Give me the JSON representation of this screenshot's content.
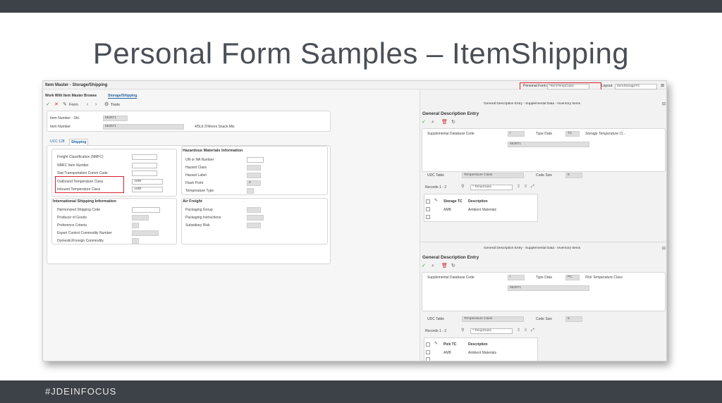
{
  "slide": {
    "title": "Personal Form Samples – ItemShipping",
    "hashtag": "#JDEINFOCUS"
  },
  "app": {
    "window_title": "Item Master - Storage/Shipping",
    "breadcrumb_1": "Work With Item Master Browse",
    "breadcrumb_2": "Storage/Shipping",
    "personal_form_label": "Personal Form:",
    "personal_form_value": "*ItemTempClass",
    "layout_label": "Layout:",
    "layout_value": "ItemStorageTC",
    "toolbar": {
      "form": "Form",
      "tools": "Tools"
    }
  },
  "item": {
    "item_number_short_label": "Item Number - Sht",
    "item_number_short_value": "552671",
    "item_number_label": "Item Number",
    "item_number_value": "552671",
    "description": "4/5Lb S'Mores Snack Mix"
  },
  "tabs": {
    "ucc": "UCC 128",
    "shipping": "Shipping"
  },
  "shipping": {
    "freight_class": "Freight Classification (NMFC)",
    "nmfc_item": "NMFC Item Number",
    "stat_comm_code": "Stat Transportation Comm Code",
    "outbound_temp": "Outbound Temperature Class",
    "outbound_temp_value": "AMB",
    "inbound_temp": "Inbound Temperature Class",
    "inbound_temp_value": "AMB"
  },
  "hazmat": {
    "header": "Hazardous Materials Information",
    "un_na": "UN or NA Number",
    "hazard_class": "Hazard Class",
    "hazard_label": "Hazard Label",
    "flash_point": "Flash Point",
    "flash_point_value": "0",
    "temperature_type": "Temperature Type"
  },
  "intl": {
    "header": "International Shipping Information",
    "harmonized": "Harmonized Shipping Code",
    "producer": "Producer of Goods",
    "preference": "Preference Criteria",
    "export_control": "Export Control Commodity Number",
    "domestic_foreign": "Domestic/Foreign Commodity"
  },
  "air": {
    "header": "Air Freight",
    "packaging_group": "Packaging Group",
    "packaging_instructions": "Packaging Instructions",
    "subsidiary_risk": "Subsidiary Risk"
  },
  "gde1": {
    "window_title": "General Description Entry - Supplemental Data - Inventory Items",
    "title": "General Description Entry",
    "supp_db_code_label": "Supplemental Database Code",
    "supp_db_code_value": "I",
    "type_data_label": "Type Data",
    "type_data_value": "TC",
    "type_data_desc": "Storage Temperature Cl...",
    "item_value": "552671",
    "udc_table_label": "UDC Table",
    "udc_table_value": "Temperature Class",
    "code_size_label": "Code Size",
    "code_size_value": "6",
    "records": "Records 1 - 2",
    "grid_dropdown": "* TempClass",
    "col1": "Storage TC",
    "col2": "Description",
    "row_code": "AMB",
    "row_desc": "Ambient Materials"
  },
  "gde2": {
    "window_title": "General Description Entry - Supplemental Data - Inventory Items",
    "title": "General Description Entry",
    "supp_db_code_label": "Supplemental Database Code",
    "supp_db_code_value": "I",
    "type_data_label": "Type Data",
    "type_data_value": "PC",
    "type_data_desc": "Pick Temperature Class",
    "item_value": "552671",
    "udc_table_label": "UDC Table",
    "udc_table_value": "Temperature Class",
    "code_size_label": "Code Size",
    "code_size_value": "6",
    "records": "Records 1 - 2",
    "grid_dropdown": "* TempClass",
    "col1": "Pick TC",
    "col2": "Description",
    "row_code": "AMB",
    "row_desc": "Ambient Materials"
  },
  "colors": {
    "highlight": "#d8202f",
    "bar": "#3d4248"
  }
}
